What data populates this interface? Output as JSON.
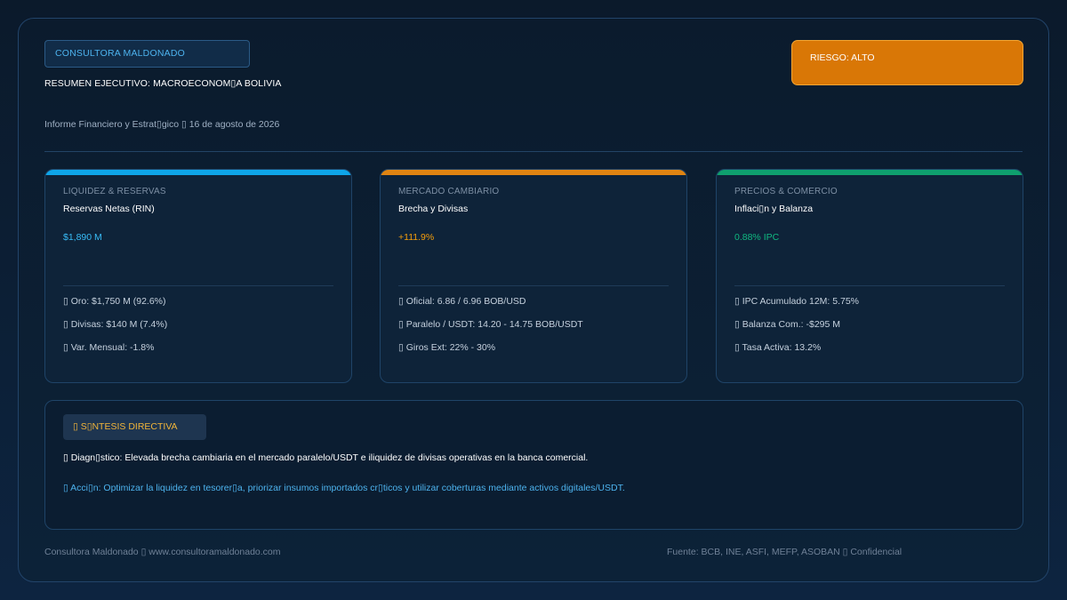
{
  "header": {
    "brand": "CONSULTORA MALDONADO",
    "title": "RESUMEN EJECUTIVO: MACROECONOM▯A BOLIVIA",
    "subtitle": "Informe Financiero y Estrat▯gico ▯ 16 de agosto de 2026",
    "risk": "RIESGO: ALTO"
  },
  "colors": {
    "liquidity": "#0ea5e9",
    "fx": "#f59e0b",
    "prices": "#10b981",
    "risk": "#d97706"
  },
  "cards": [
    {
      "category": "LIQUIDEZ & RESERVAS",
      "name": "Reservas Netas (RIN)",
      "value": "$1,890 M",
      "details": [
        "▯ Oro: $1,750 M (92.6%)",
        "▯ Divisas: $140 M (7.4%)",
        "▯ Var. Mensual: -1.8%"
      ]
    },
    {
      "category": "MERCADO CAMBIARIO",
      "name": "Brecha y Divisas",
      "value": "+111.9%",
      "details": [
        "▯ Oficial: 6.86 / 6.96 BOB/USD",
        "▯ Paralelo / USDT: 14.20 - 14.75 BOB/USDT",
        "▯ Giros Ext: 22% - 30%"
      ]
    },
    {
      "category": "PRECIOS & COMERCIO",
      "name": "Inflaci▯n y Balanza",
      "value": "0.88% IPC",
      "details": [
        "▯ IPC Acumulado 12M: 5.75%",
        "▯ Balanza Com.: -$295 M",
        "▯ Tasa Activa: 13.2%"
      ]
    }
  ],
  "synthesis": {
    "label": "▯ S▯NTESIS DIRECTIVA",
    "diagnosis": "▯ Diagn▯stico: Elevada brecha cambiaria en el mercado paralelo/USDT e iliquidez de divisas operativas en la banca comercial.",
    "action": "▯ Acci▯n: Optimizar la liquidez en tesorer▯a, priorizar insumos importados cr▯ticos y utilizar coberturas mediante activos digitales/USDT."
  },
  "footer": {
    "left": "Consultora Maldonado ▯ www.consultoramaldonado.com",
    "right": "Fuente: BCB, INE, ASFI, MEFP, ASOBAN ▯ Confidencial"
  }
}
